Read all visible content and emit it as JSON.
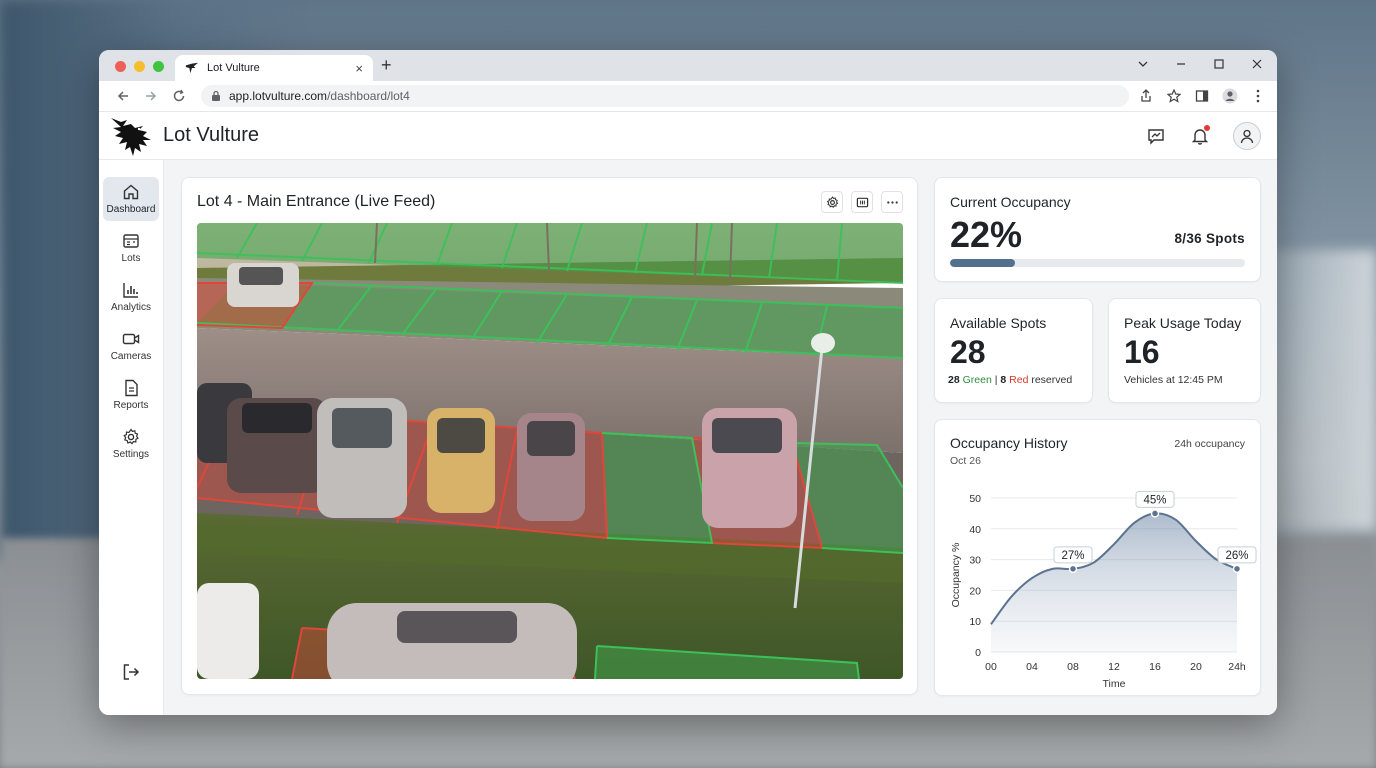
{
  "browser": {
    "tab_title": "Lot Vulture",
    "tab_close": "×",
    "new_tab": "+",
    "url_host": "app.lotvulture.com",
    "url_path": "/dashboard/lot4"
  },
  "header": {
    "brand": "Lot Vulture"
  },
  "sidebar": {
    "items": [
      {
        "label": "Dashboard",
        "icon": "home-icon",
        "active": true
      },
      {
        "label": "Lots",
        "icon": "lots-icon"
      },
      {
        "label": "Analytics",
        "icon": "analytics-icon"
      },
      {
        "label": "Cameras",
        "icon": "camera-icon"
      },
      {
        "label": "Reports",
        "icon": "report-icon"
      },
      {
        "label": "Settings",
        "icon": "gear-icon"
      }
    ]
  },
  "feed": {
    "title": "Lot 4 - Main Entrance (Live Feed)"
  },
  "occupancy": {
    "label": "Current Occupancy",
    "percent_text": "22%",
    "percent": 22,
    "spots_text": "8/36 Spots"
  },
  "available": {
    "label": "Available Spots",
    "value": "28",
    "green_count": "28",
    "green_word": "Green",
    "sep": "|",
    "red_count": "8",
    "red_word": "Red",
    "reserved_word": "reserved"
  },
  "peak": {
    "label": "Peak Usage Today",
    "value": "16",
    "sub": "Vehicles at 12:45 PM"
  },
  "history": {
    "title": "Occupancy History",
    "date": "Oct 26",
    "range_label": "24h occupancy"
  },
  "colors": {
    "accent": "#54708f",
    "free_spot": "#2e8b3e",
    "taken_spot": "#d23b2b"
  },
  "chart_data": {
    "type": "area",
    "title": "Occupancy History",
    "xlabel": "Time",
    "ylabel": "Occupancy %",
    "x_ticks": [
      "00",
      "04",
      "08",
      "12",
      "16",
      "20",
      "24h"
    ],
    "y_ticks": [
      0,
      10,
      20,
      30,
      40,
      50
    ],
    "ylim": [
      0,
      50
    ],
    "xlim": [
      0,
      24
    ],
    "grid": true,
    "series": [
      {
        "x": [
          0,
          2,
          4,
          6,
          8,
          10,
          12,
          14,
          16,
          18,
          20,
          22,
          24
        ],
        "y": [
          9,
          18,
          24,
          27,
          27,
          29,
          35,
          42,
          45,
          43,
          36,
          30,
          27
        ]
      }
    ],
    "annotations": [
      {
        "x": 8,
        "y": 27,
        "label": "27%"
      },
      {
        "x": 16,
        "y": 45,
        "label": "45%"
      },
      {
        "x": 24,
        "y": 27,
        "label": "26%"
      }
    ]
  }
}
